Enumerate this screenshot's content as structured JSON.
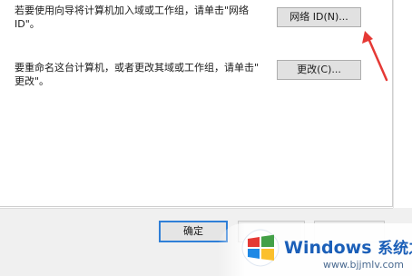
{
  "dialog": {
    "network_id_text": "若要使用向导将计算机加入域或工作组，请单击\"网络\nID\"。",
    "network_id_button": "网络 ID(N)...",
    "rename_text": "要重命名这台计算机，或者更改其域或工作组，请单击\"\n更改\"。",
    "change_button": "更改(C)...",
    "ok_button": "确定",
    "cancel_button": "",
    "apply_button": ""
  },
  "watermark": {
    "brand": "Windows",
    "brand_cn": "系统之家",
    "url": "www.bjjmlv.com"
  },
  "colors": {
    "annotation_arrow": "#e53935",
    "watermark_blue": "#1b5fb8"
  },
  "icons": {
    "annotation": "red-arrow-icon",
    "logo": "windows-logo-icon"
  }
}
